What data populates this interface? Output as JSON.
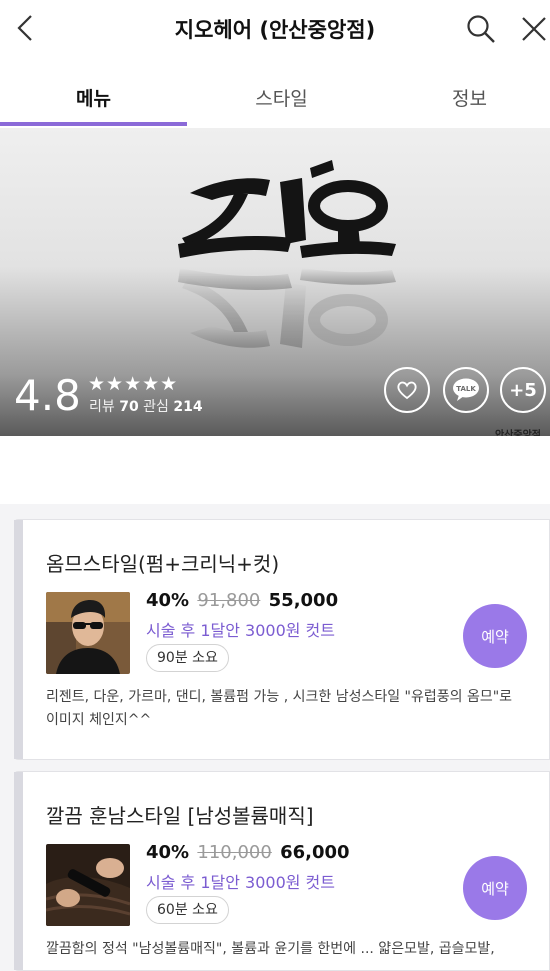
{
  "header": {
    "title": "지오헤어 (안산중앙점)",
    "back_icon": "chevron-left-icon",
    "search_icon": "search-icon",
    "close_icon": "close-icon"
  },
  "tabs": [
    {
      "label": "메뉴",
      "active": true
    },
    {
      "label": "스타일",
      "active": false
    },
    {
      "label": "정보",
      "active": false
    }
  ],
  "colors": {
    "accent": "#8b6ad8",
    "reserve_button": "#9a79e8",
    "promo_text": "#7b5cd1"
  },
  "hero": {
    "logo_text": "지오",
    "rating": "4.8",
    "stars": "★★★★★",
    "review_label": "리뷰",
    "review_count": "70",
    "interest_label": "관심",
    "interest_count": "214",
    "more_count": "+5",
    "talk_label": "TALK",
    "corner_text": "안산중앙점"
  },
  "menu_items": [
    {
      "name": "옴므스타일(펌+크리닉+컷)",
      "discount": "40%",
      "original_price": "91,800",
      "price": "55,000",
      "promo": "시술 후 1달안 3000원 컷트",
      "duration": "90분 소요",
      "description": "리젠트, 다운, 가르마, 댄디, 볼륨펌 가능 , 시크한 남성스타일 \"유럽풍의 옴므\"로 이미지 체인지^^",
      "reserve_label": "예약"
    },
    {
      "name": "깔끔 훈남스타일 [남성볼륨매직]",
      "discount": "40%",
      "original_price": "110,000",
      "price": "66,000",
      "promo": "시술 후 1달안 3000원 컷트",
      "duration": "60분 소요",
      "description": "깔끔함의 정석 \"남성볼륨매직\", 볼륨과 윤기를 한번에 ... 얇은모발, 곱슬모발,",
      "reserve_label": "예약"
    }
  ]
}
